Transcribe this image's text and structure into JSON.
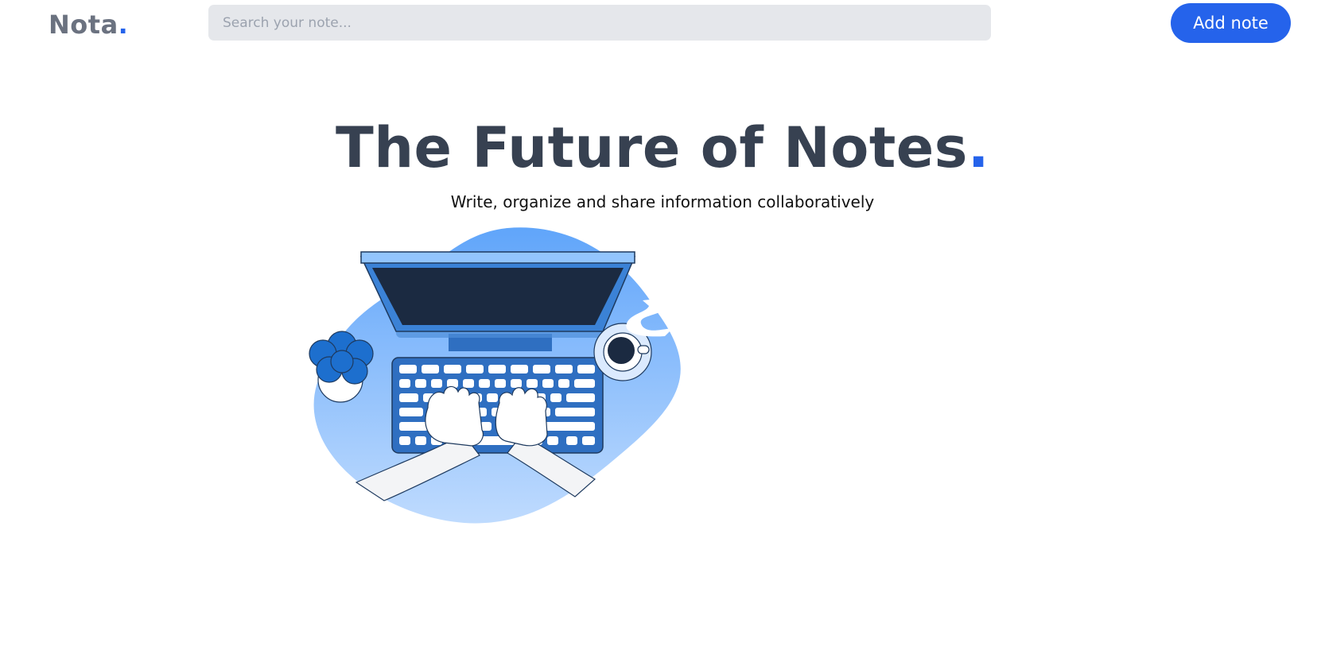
{
  "header": {
    "logo_text": "Nota",
    "logo_dot": ".",
    "search_placeholder": "Search your note...",
    "add_note_label": "Add note"
  },
  "hero": {
    "title": "The Future of Notes",
    "title_dot": ".",
    "subtitle": "Write, organize and share information collaboratively"
  },
  "illustration": {
    "icon": "desk-typing-illustration"
  },
  "colors": {
    "accent": "#2563eb",
    "title": "#374151",
    "logo": "#6b7280",
    "search_bg": "#e5e7eb"
  }
}
